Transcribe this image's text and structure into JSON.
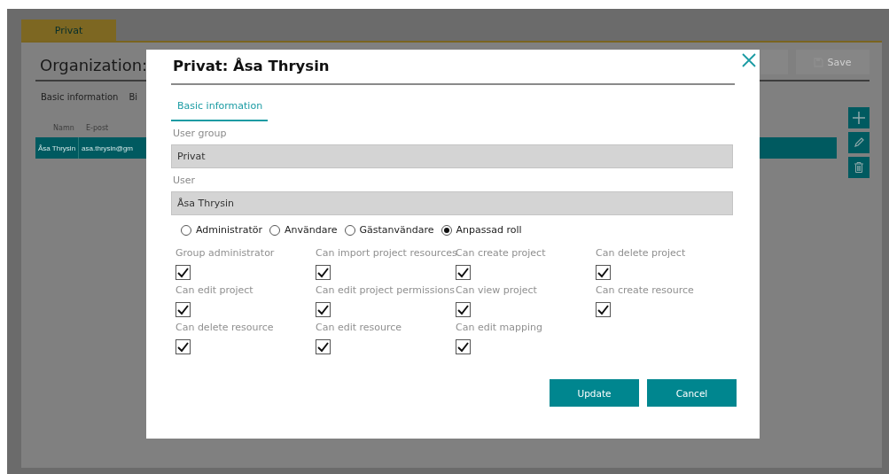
{
  "background": {
    "tabs": [
      {
        "label": "Privat",
        "selected": true
      }
    ],
    "title": "Organization:",
    "toolbar": [
      {
        "label": "Save"
      }
    ],
    "section_tabs": [
      "Basic information",
      "Bi"
    ],
    "table": {
      "columns": [
        "Namn",
        "E-post"
      ],
      "rows": [
        {
          "cells": [
            "Åsa Thrysin",
            "asa.thrysin@gm"
          ],
          "selected": true
        }
      ]
    }
  },
  "dialog": {
    "title": "Privat: Åsa Thrysin",
    "tabs": [
      {
        "label": "Basic information",
        "selected": true
      }
    ],
    "fields": [
      {
        "label": "User group",
        "value": "Privat"
      },
      {
        "label": "User",
        "value": "Åsa Thrysin"
      }
    ],
    "roles": [
      {
        "label": "Administratör",
        "selected": false
      },
      {
        "label": "Användare",
        "selected": false
      },
      {
        "label": "Gästanvändare",
        "selected": false
      },
      {
        "label": "Anpassad roll",
        "selected": true
      }
    ],
    "permissions": [
      {
        "label": "Group administrator",
        "checked": true
      },
      {
        "label": "Can import project resources",
        "checked": true
      },
      {
        "label": "Can create project",
        "checked": true
      },
      {
        "label": "Can delete project",
        "checked": true
      },
      {
        "label": "Can edit project",
        "checked": true
      },
      {
        "label": "Can edit project permissions",
        "checked": true
      },
      {
        "label": "Can view project",
        "checked": true
      },
      {
        "label": "Can create resource",
        "checked": true
      },
      {
        "label": "Can delete resource",
        "checked": true
      },
      {
        "label": "Can edit resource",
        "checked": true
      },
      {
        "label": "Can edit mapping",
        "checked": true
      }
    ],
    "buttons": [
      "Update",
      "Cancel"
    ]
  }
}
